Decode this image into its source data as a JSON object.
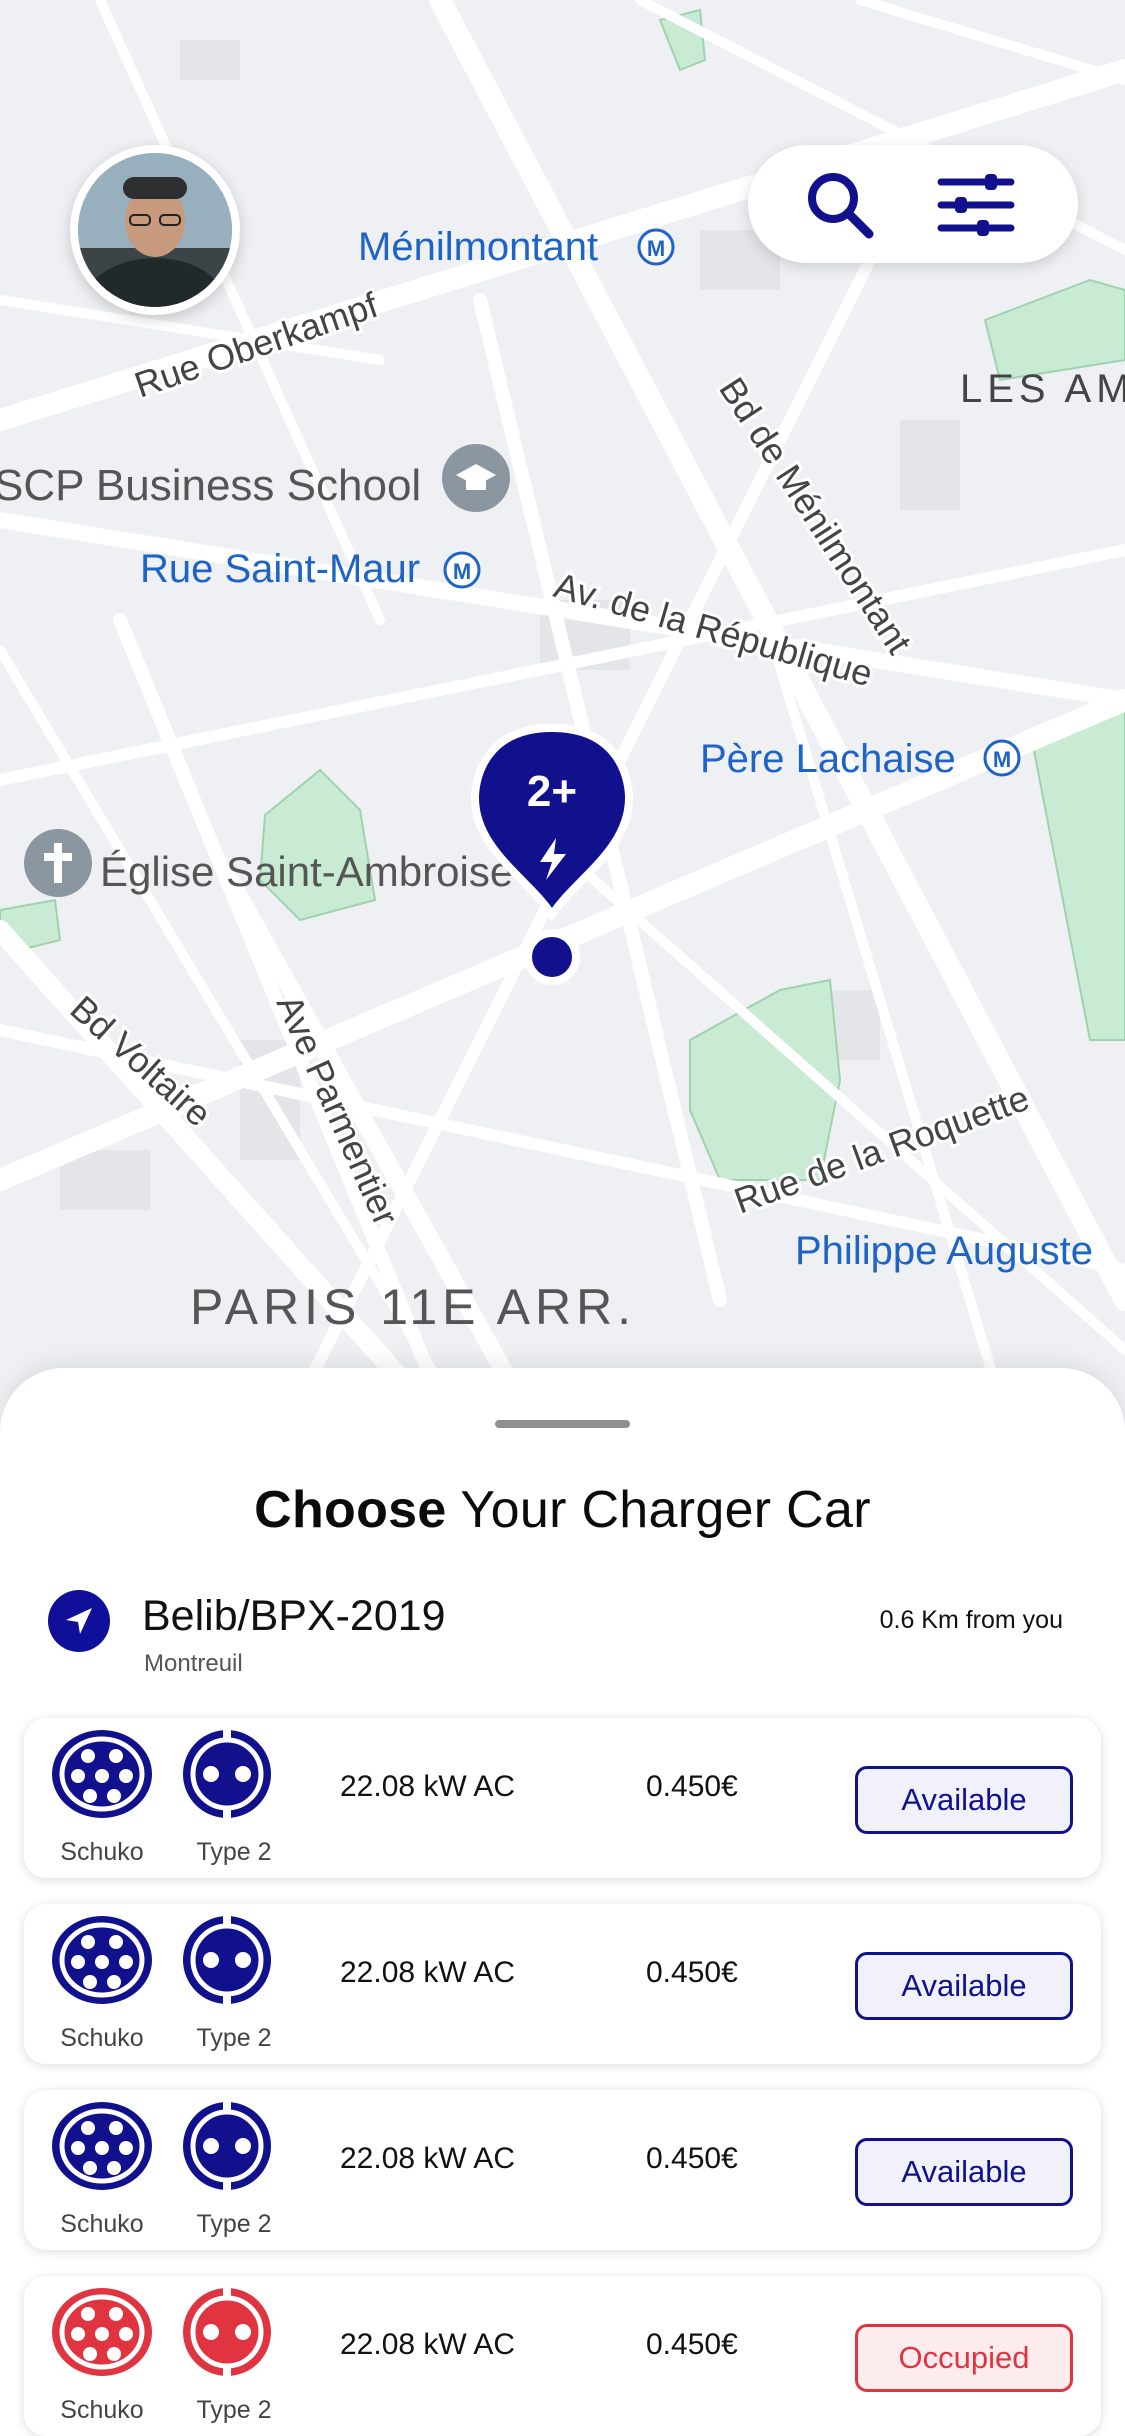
{
  "map": {
    "labels": {
      "menilmontant": "Ménilmontant",
      "rue_oberkampf": "Rue Oberkampf",
      "les_am": "LES AM",
      "bd_de_menilmontant": "Bd de Ménilmontant",
      "scp_business_school": "SCP Business School",
      "rue_saint_maur": "Rue Saint-Maur",
      "av_republique": "Av. de la République",
      "pere_lachaise": "Père Lachaise",
      "eglise_saint_ambroise": "Église Saint-Ambroise",
      "bd_voltaire": "Bd Voltaire",
      "ave_parmentier": "Ave Parmentier",
      "rue_de_la_roquette": "Rue de la Roquette",
      "philippe_auguste": "Philippe Auguste",
      "paris_11e": "PARIS 11E ARR."
    },
    "marker": {
      "count": "2+"
    },
    "colors": {
      "accent": "#11118d",
      "transit": "#1e63c6",
      "park": "#c9ead3"
    }
  },
  "topbar": {
    "search_icon": "search-icon",
    "filter_icon": "filter-sliders-icon"
  },
  "sheet": {
    "title_bold": "Choose",
    "title_rest": " Your Charger Car",
    "station": {
      "name": "Belib/BPX-2019",
      "city": "Montreuil",
      "distance": "0.6 Km from you"
    },
    "chargers": [
      {
        "plug1": "Schuko",
        "plug2": "Type 2",
        "power": "22.08 kW AC",
        "price": "0.450€",
        "status": "Available",
        "color": "#11118d"
      },
      {
        "plug1": "Schuko",
        "plug2": "Type 2",
        "power": "22.08 kW AC",
        "price": "0.450€",
        "status": "Available",
        "color": "#11118d"
      },
      {
        "plug1": "Schuko",
        "plug2": "Type 2",
        "power": "22.08 kW AC",
        "price": "0.450€",
        "status": "Available",
        "color": "#11118d"
      },
      {
        "plug1": "Schuko",
        "plug2": "Type 2",
        "power": "22.08 kW AC",
        "price": "0.450€",
        "status": "Occupied",
        "color": "#e03540"
      }
    ]
  }
}
